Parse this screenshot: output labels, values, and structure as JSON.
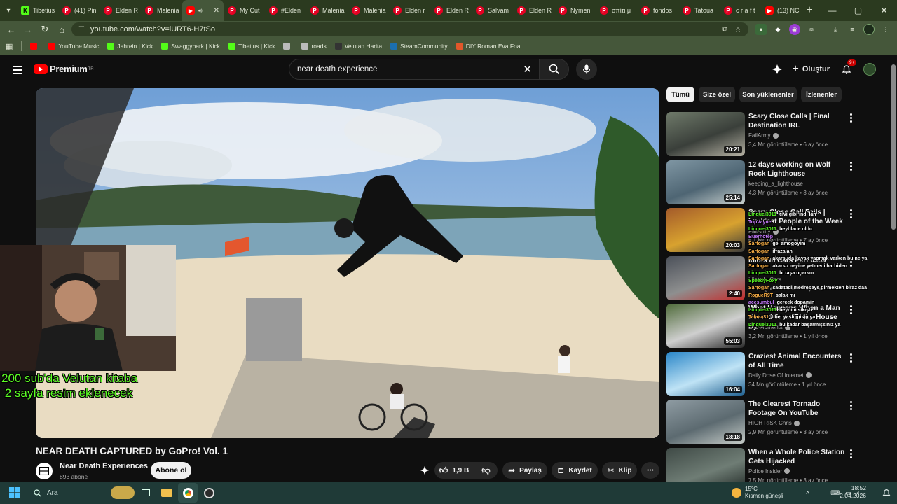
{
  "browser": {
    "tabs": [
      {
        "label": "Tibetius",
        "icon": "kick"
      },
      {
        "label": "(41) Pin",
        "icon": "pinterest"
      },
      {
        "label": "Elden R",
        "icon": "pinterest"
      },
      {
        "label": "Malenia",
        "icon": "pinterest"
      },
      {
        "label": "",
        "icon": "youtube",
        "active": true
      },
      {
        "label": "My Cut",
        "icon": "pinterest"
      },
      {
        "label": "#Elden",
        "icon": "pinterest"
      },
      {
        "label": "Malenia",
        "icon": "pinterest"
      },
      {
        "label": "Malenia",
        "icon": "pinterest"
      },
      {
        "label": "Elden r",
        "icon": "pinterest"
      },
      {
        "label": "Elden R",
        "icon": "pinterest"
      },
      {
        "label": "Salvam",
        "icon": "pinterest"
      },
      {
        "label": "Elden R",
        "icon": "pinterest"
      },
      {
        "label": "Nymen",
        "icon": "pinterest"
      },
      {
        "label": "σπίτι μ",
        "icon": "pinterest"
      },
      {
        "label": "fondos",
        "icon": "pinterest"
      },
      {
        "label": "Tatoua",
        "icon": "pinterest"
      },
      {
        "label": "c r a f t",
        "icon": "pinterest"
      },
      {
        "label": "(13) NC",
        "icon": "youtube"
      }
    ],
    "url": "youtube.com/watch?v=iURT6-H7tSo",
    "bookmarks": [
      {
        "label": "",
        "color": "#ff0000"
      },
      {
        "label": "YouTube Music",
        "color": "#ff0000"
      },
      {
        "label": "Jahrein | Kick",
        "color": "#53fc18"
      },
      {
        "label": "Swaggybark | Kick",
        "color": "#53fc18"
      },
      {
        "label": "Tibetius | Kick",
        "color": "#53fc18"
      },
      {
        "label": "",
        "color": "#bbbbbb"
      },
      {
        "label": "roads",
        "color": "#bbbbbb"
      },
      {
        "label": "Velutan Harita",
        "color": "#333333"
      },
      {
        "label": "SteamCommunity",
        "color": "#1b6fb0"
      },
      {
        "label": "DIY Roman Eva Foa...",
        "color": "#e2572a"
      }
    ]
  },
  "youtube": {
    "logo_text": "Premium",
    "logo_region": "TR",
    "search_query": "near death experience",
    "create_label": "Oluştur",
    "notif_badge": "9+",
    "video_title": "NEAR DEATH CAPTURED by GoPro! Vol. 1",
    "channel_name": "Near Death Experiences",
    "channel_subs": "893 abone",
    "subscribe_label": "Abone ol",
    "like_count": "1,9 B",
    "share_label": "Paylaş",
    "save_label": "Kaydet",
    "clip_label": "Klip",
    "overlay_text": "200 sub'da Velutan kitaba\n 2 sayfa resim eklenecek",
    "chips": [
      "Tümü",
      "Size özel",
      "Son yüklenenler",
      "İzlenenler"
    ],
    "recommendations": [
      {
        "title": "Scary Close Calls | Final Destination IRL",
        "channel": "FailArmy",
        "meta": "3,4 Mn görüntüleme • 6 ay önce",
        "duration": "20:21",
        "verified": true,
        "palette": [
          "#6f7a6a",
          "#3a3f3a",
          "#b6b2a4"
        ]
      },
      {
        "title": "12 days working on Wolf Rock Lighthouse",
        "channel": "keeping_a_lighthouse",
        "meta": "4,3 Mn görüntüleme • 3 ay önce",
        "duration": "25:14",
        "verified": false,
        "palette": [
          "#7f96a3",
          "#4e6573",
          "#c9d1cf"
        ]
      },
      {
        "title": "Scary Close Call Fails | Luckiest People of the Week",
        "channel": "FailArmy",
        "meta": "5,1 Mn görüntüleme • 7 ay önce",
        "duration": "20:03",
        "verified": true,
        "palette": [
          "#a35a2a",
          "#d8a22f",
          "#3b3b3b"
        ]
      },
      {
        "title": "Idiots In Cars Part 5559",
        "channel": "Idiots In Cars",
        "meta": "490 B görüntüleme • 1 ay önce",
        "duration": "2:40",
        "verified": false,
        "palette": [
          "#4b5059",
          "#8e8f8f",
          "#c52b2b"
        ]
      },
      {
        "title": "What Happens When a Man Remodels an Entire House By...",
        "channel": "Eric Moments",
        "meta": "3,2 Mn görüntüleme • 1 yıl önce",
        "duration": "55:03",
        "verified": true,
        "palette": [
          "#4f6b3a",
          "#cfcfcf",
          "#2a2a2a"
        ]
      },
      {
        "title": "Craziest Animal Encounters of All Time",
        "channel": "Daily Dose Of Internet",
        "meta": "34 Mn görüntüleme • 1 yıl önce",
        "duration": "16:04",
        "verified": true,
        "palette": [
          "#2a86c8",
          "#bfe3f5",
          "#1e5f8f"
        ]
      },
      {
        "title": "The Clearest Tornado Footage On YouTube",
        "channel": "HIGH RISK Chris",
        "meta": "2,9 Mn görüntüleme • 3 ay önce",
        "duration": "18:18",
        "verified": true,
        "palette": [
          "#8f9ca3",
          "#5c6a70",
          "#c6ccc8"
        ]
      },
      {
        "title": "When a Whole Police Station Gets Hijacked",
        "channel": "Police Insider",
        "meta": "7,5 Mn görüntüleme • 3 ay önce",
        "duration": "",
        "verified": true,
        "palette": [
          "#3f4a46",
          "#6f7d75",
          "#1e2623"
        ]
      }
    ],
    "chat": [
      {
        "user": "Linquei3011",
        "ucolor": "#5cff24",
        "msg": "civi gibi indi lan"
      },
      {
        "user": "TopVayne",
        "ucolor": "#c87cff",
        "msg": ""
      },
      {
        "user": "Linquei3011",
        "ucolor": "#5cff24",
        "msg": "beyblade oldu"
      },
      {
        "user": "Buerhotep",
        "ucolor": "#c87cff",
        "msg": ""
      },
      {
        "user": "Sartogan",
        "ucolor": "#ffb347",
        "msg": "gel amogoyim"
      },
      {
        "user": "Sartogan",
        "ucolor": "#ffb347",
        "msg": "ifrazalah"
      },
      {
        "user": "Sartogan",
        "ucolor": "#ffb347",
        "msg": "akarsuda kayak yapmak varken bu ne ya"
      },
      {
        "user": "Sartogan",
        "ucolor": "#ffb347",
        "msg": "akarsu neyine yetmedi harbiden"
      },
      {
        "user": "Linquei3011",
        "ucolor": "#5cff24",
        "msg": "bi taşa uçarsın"
      },
      {
        "user": "SpeedyFoxy",
        "ucolor": "#5cff24",
        "msg": ""
      },
      {
        "user": "Sartogan",
        "ucolor": "#ffb347",
        "msg": "şadatadi medreseye girmekten biraz daa"
      },
      {
        "user": "RogueR9T",
        "ucolor": "#ffb347",
        "msg": "salak mı"
      },
      {
        "user": "acesumbul",
        "ucolor": "#c87cff",
        "msg": "gerçek dopamin"
      },
      {
        "user": "Linquei3011",
        "ucolor": "#5cff24",
        "msg": "beynim sıkıştı"
      },
      {
        "user": "Talaaa31",
        "ucolor": "#ffb347",
        "msg": "tibet yasli misin ya"
      },
      {
        "user": "Linquei3011",
        "ucolor": "#5cff24",
        "msg": "bu kadar başarmışsınız ya"
      }
    ]
  },
  "taskbar": {
    "search_label": "Ara",
    "weather_temp": "15°C",
    "weather_desc": "Kısmen güneşli",
    "time": "18:52",
    "date": "2.04.2026"
  }
}
